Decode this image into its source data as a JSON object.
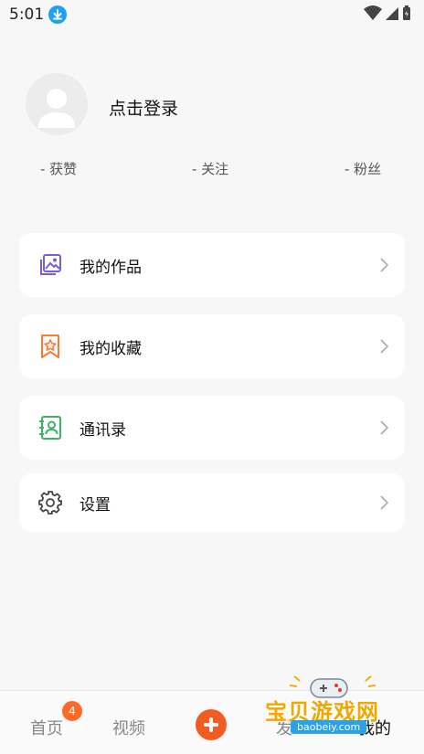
{
  "status_bar": {
    "time": "5:01"
  },
  "profile": {
    "login_text": "点击登录"
  },
  "stats": {
    "likes": "- 获赞",
    "following": "- 关注",
    "fans": "- 粉丝"
  },
  "menu": [
    {
      "label": "我的作品",
      "icon": "gallery-icon",
      "color": "#7b5cd6"
    },
    {
      "label": "我的收藏",
      "icon": "bookmark-star-icon",
      "color": "#ff7a2f"
    },
    {
      "label": "通讯录",
      "icon": "contacts-icon",
      "color": "#3db36a"
    },
    {
      "label": "设置",
      "icon": "gear-icon",
      "color": "#444444"
    }
  ],
  "bottom_nav": {
    "home": "首页",
    "home_badge": "4",
    "video": "视频",
    "publish_partial": "发",
    "mine": "我的"
  },
  "watermark": {
    "title": "宝贝游戏网",
    "url": "baobeiy.com"
  },
  "colors": {
    "accent": "#f35b22",
    "background": "#f7f7f7"
  }
}
